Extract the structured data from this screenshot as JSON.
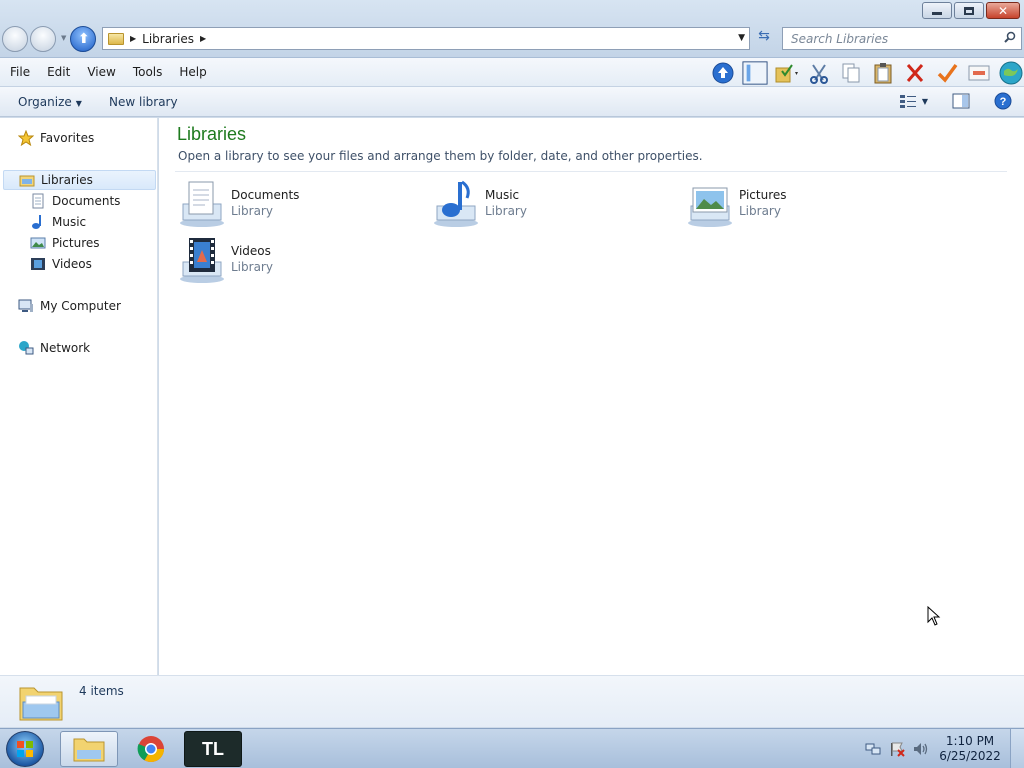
{
  "window": {
    "controls": {
      "minimize": "minimize",
      "restore": "restore",
      "close": "close"
    }
  },
  "nav": {
    "breadcrumb": "Libraries",
    "search_placeholder": "Search Libraries"
  },
  "menu": {
    "items": [
      "File",
      "Edit",
      "View",
      "Tools",
      "Help"
    ]
  },
  "toolbar_icons": [
    "up-arrow-icon",
    "preview-pane-icon",
    "folder-check-icon",
    "cut-icon",
    "copy-icon",
    "paste-icon",
    "delete-icon",
    "checkmark-icon",
    "properties-icon",
    "globe-icon"
  ],
  "commandbar": {
    "organize": "Organize",
    "new_library": "New library"
  },
  "sidebar": {
    "favorites": "Favorites",
    "libraries": "Libraries",
    "documents": "Documents",
    "music": "Music",
    "pictures": "Pictures",
    "videos": "Videos",
    "computer": "My Computer",
    "network": "Network"
  },
  "main": {
    "title": "Libraries",
    "subtitle": "Open a library to see your files and arrange them by folder, date, and other properties.",
    "items": [
      {
        "name": "Documents",
        "type": "Library",
        "icon": "documents-library-icon"
      },
      {
        "name": "Music",
        "type": "Library",
        "icon": "music-library-icon"
      },
      {
        "name": "Pictures",
        "type": "Library",
        "icon": "pictures-library-icon"
      },
      {
        "name": "Videos",
        "type": "Library",
        "icon": "videos-library-icon"
      }
    ]
  },
  "details": {
    "count": "4 items"
  },
  "taskbar": {
    "apps": [
      "windows-explorer",
      "google-chrome",
      "TL"
    ],
    "tl_label": "TL",
    "time": "1:10 PM",
    "date": "6/25/2022"
  },
  "colors": {
    "title_green": "#1e7a1e",
    "accent_blue": "#1f5aa5"
  }
}
